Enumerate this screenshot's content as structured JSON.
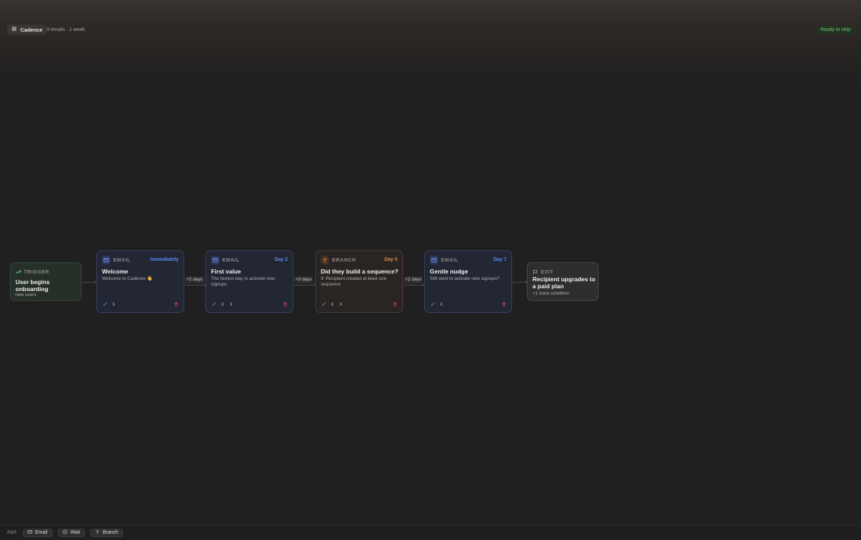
{
  "header": {
    "title": "Cadence",
    "meta": "3 emails · 1 week",
    "status": "Ready to ship",
    "status_color": "#7bbf7b"
  },
  "nodes": [
    {
      "kind": "TRIGGER",
      "icon": "trend-up-icon",
      "title": "User begins onboarding",
      "sub": "new users"
    },
    {
      "kind": "EMAIL",
      "icon": "mail-icon",
      "timing": "Immediately",
      "title": "Welcome",
      "sub": "Welcome to Cadence 👋"
    },
    {
      "kind": "EMAIL",
      "icon": "mail-icon",
      "timing": "Day 2",
      "title": "First value",
      "sub": "The fastest way to activate new signups"
    },
    {
      "kind": "BRANCH",
      "icon": "branch-icon",
      "timing": "Day 5",
      "title": "Did they build a sequence?",
      "sub": "If: Recipient created at least one sequence"
    },
    {
      "kind": "EMAIL",
      "icon": "mail-icon",
      "timing": "Day 7",
      "title": "Gentle nudge",
      "sub": "Still want to activate new signups?"
    },
    {
      "kind": "EXIT",
      "icon": "flag-icon",
      "title": "Recipient upgrades to a paid plan",
      "sub": "+1 more condition"
    }
  ],
  "delays": [
    "+2 days",
    "+3 days",
    "+2 days"
  ],
  "colors": {
    "email_accent": "#5b8cf0",
    "branch_accent": "#e48a36",
    "trigger_accent": "#5cbf6a",
    "delete_accent": "#e05050"
  },
  "bottom": {
    "add_label": "Add:",
    "buttons": [
      {
        "label": "Email",
        "icon": "mail-icon"
      },
      {
        "label": "Wait",
        "icon": "clock-icon"
      },
      {
        "label": "Branch",
        "icon": "branch-icon"
      }
    ]
  }
}
